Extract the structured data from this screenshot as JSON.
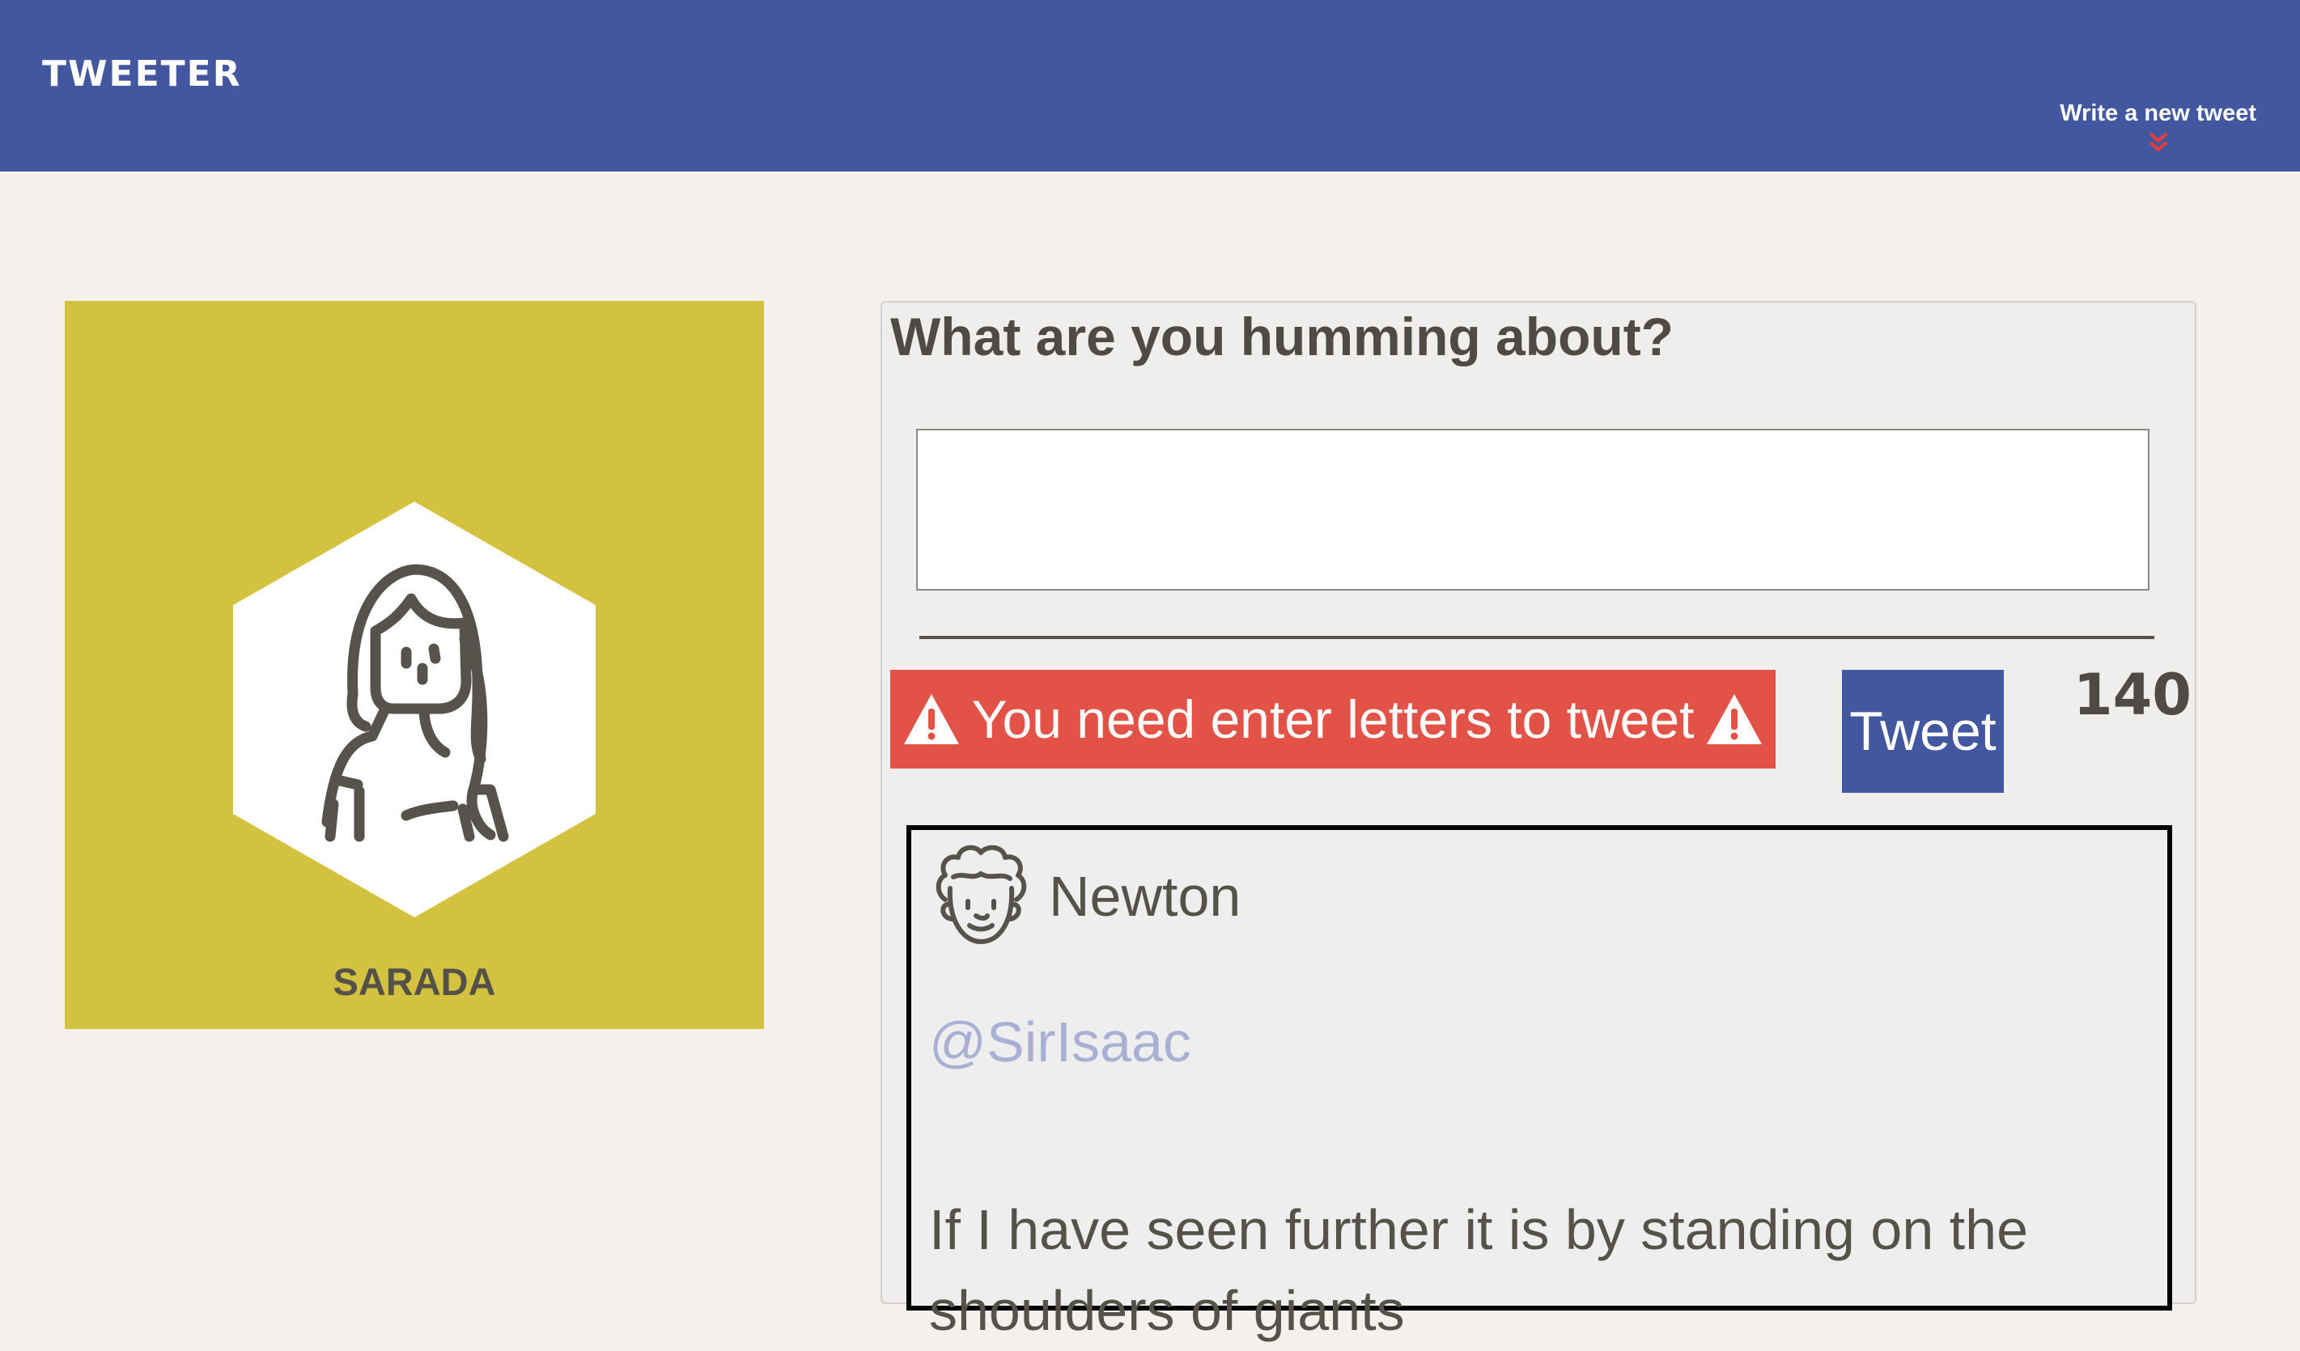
{
  "nav": {
    "logo": "TWEETER",
    "compose_link": "Write a new tweet",
    "compose_icon": "double-chevron-down-icon",
    "chevron_color": "#e0403a"
  },
  "profile": {
    "name": "SARADA",
    "avatar_icon": "girl-avatar-icon",
    "background_color": "#d3c240"
  },
  "composer": {
    "heading": "What are you humming about?",
    "input_value": "",
    "error_message": "You need enter letters to tweet",
    "error_icon": "warning-triangle-icon",
    "tweet_button": "Tweet",
    "char_counter": "140"
  },
  "tweets": [
    {
      "author": "Newton",
      "handle": "@SirIsaac",
      "avatar_icon": "newton-avatar-icon",
      "body": "If I have seen further it is by standing on the shoulders of giants"
    }
  ],
  "colors": {
    "nav": "#4356a0",
    "page_background": "#f4f1ed",
    "error": "#e25246",
    "button": "#4356a0",
    "handle": "#a9b0d4"
  }
}
